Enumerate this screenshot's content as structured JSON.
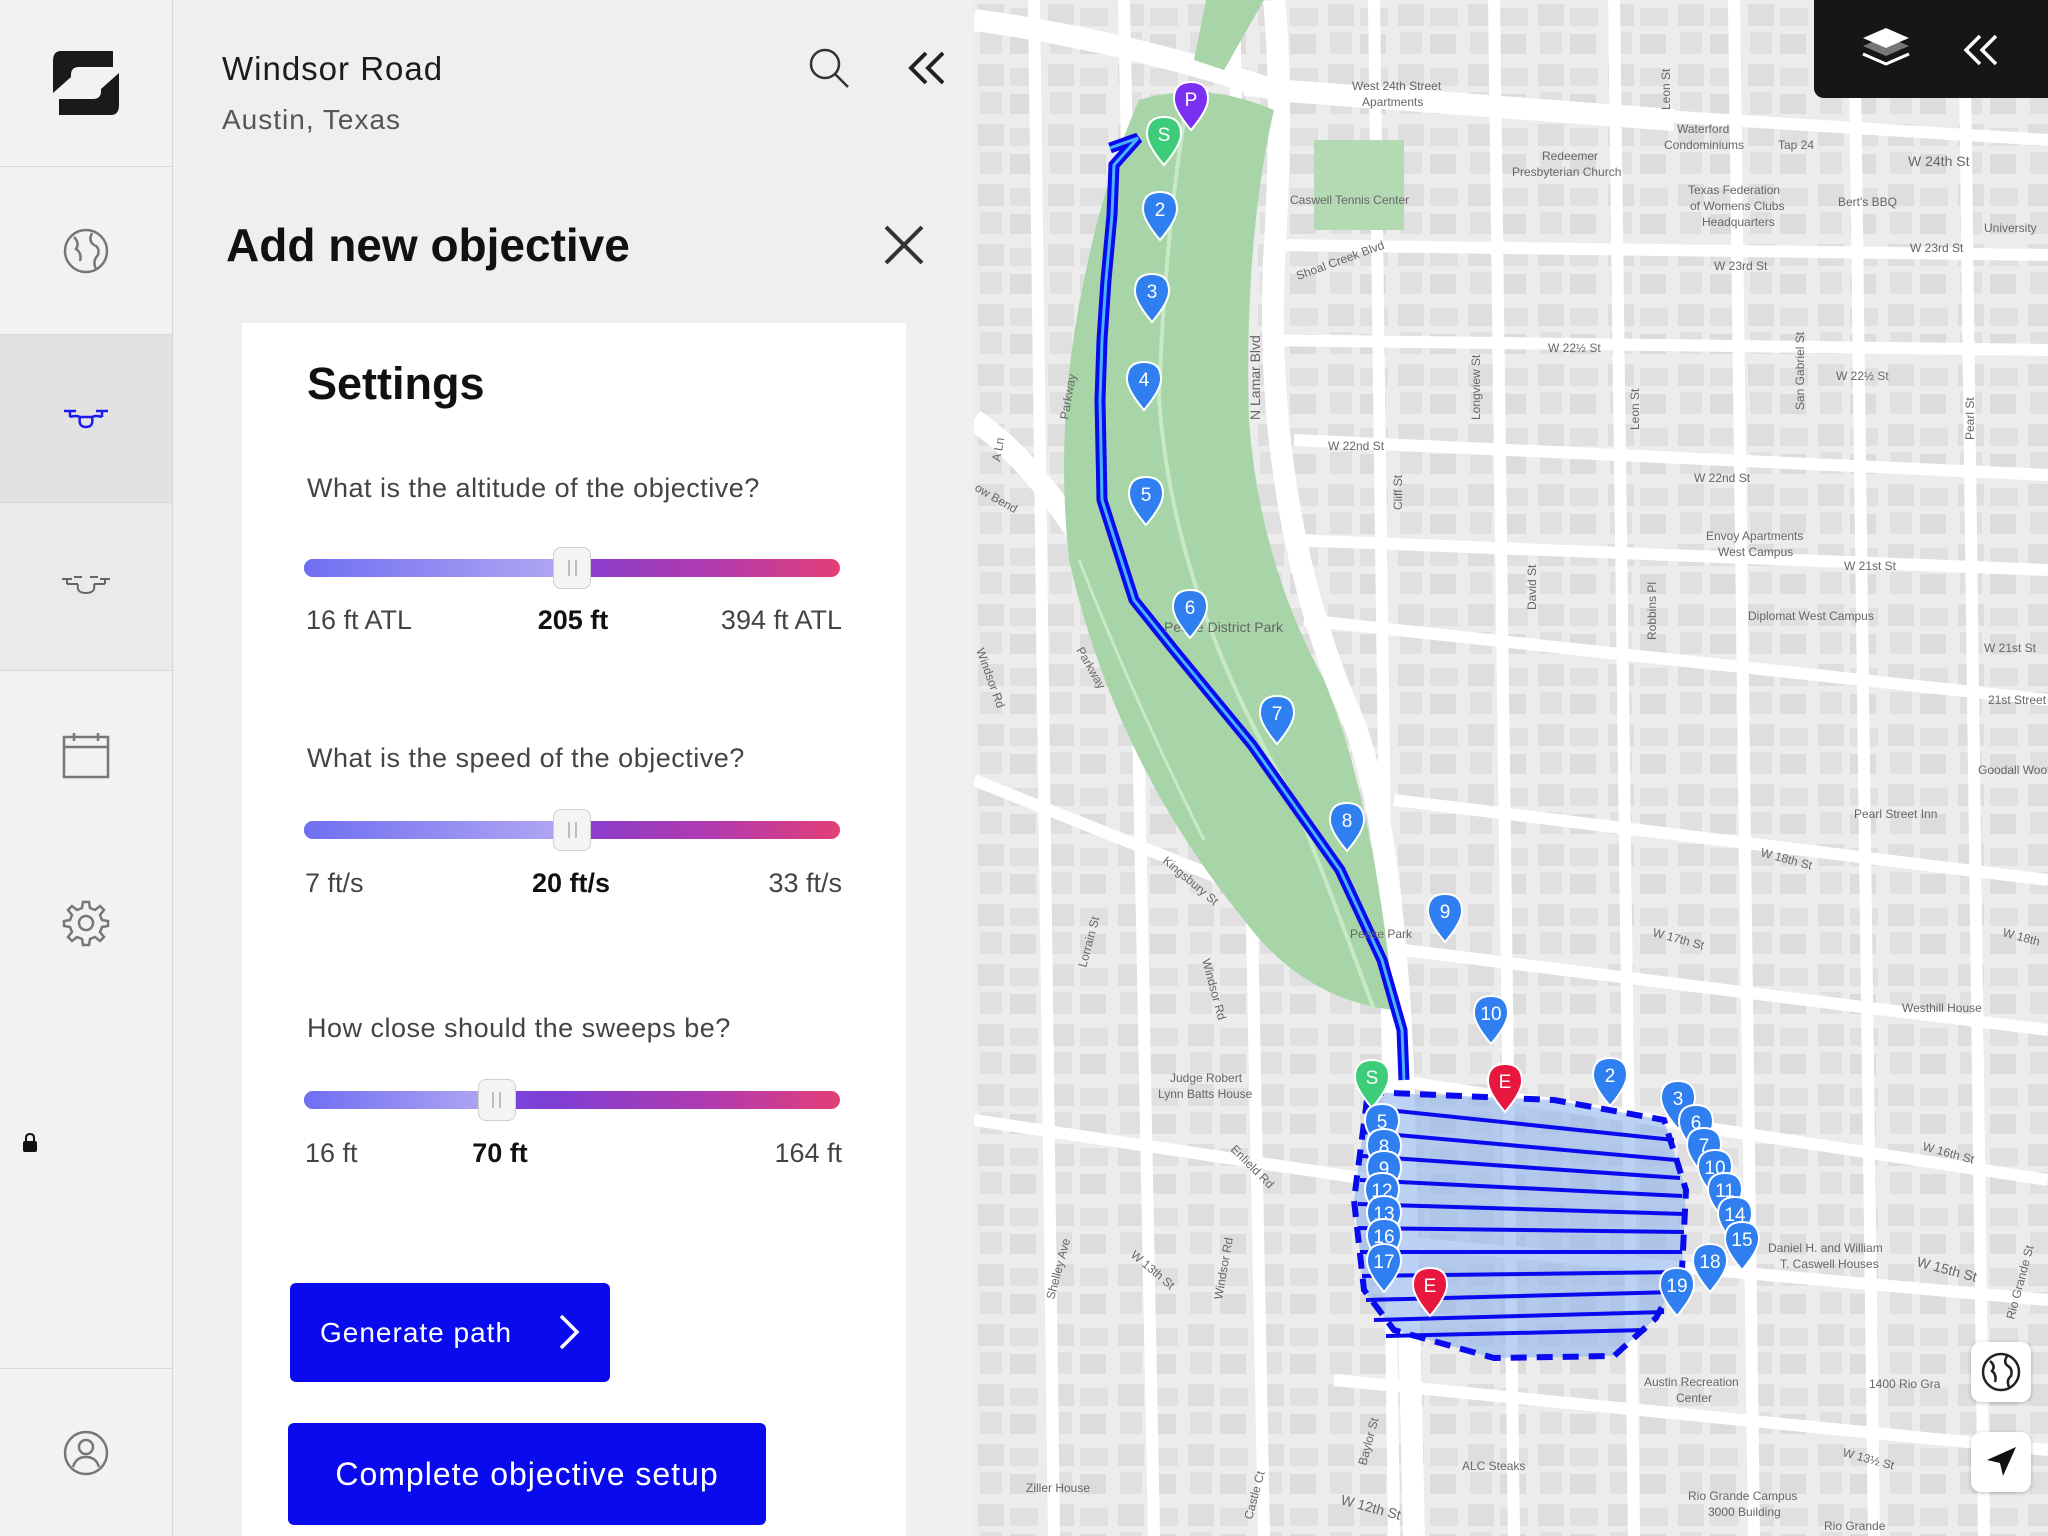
{
  "location": {
    "title": "Windsor Road",
    "subtitle": "Austin, Texas"
  },
  "objective": {
    "title": "Add new objective",
    "settings_heading": "Settings",
    "altitude": {
      "question": "What is the altitude of the objective?",
      "min_label": "16 ft ATL",
      "value_label": "205 ft",
      "max_label": "394 ft ATL",
      "fraction": 0.5
    },
    "speed": {
      "question": "What is the speed of the objective?",
      "min_label": "7 ft/s",
      "value_label": "20 ft/s",
      "max_label": "33 ft/s",
      "fraction": 0.5
    },
    "sweeps": {
      "question": "How close should the sweeps be?",
      "min_label": "16 ft",
      "value_label": "70 ft",
      "max_label": "164 ft",
      "fraction": 0.36
    },
    "generate_label": "Generate path",
    "complete_label": "Complete objective setup"
  },
  "rail": {
    "items": [
      {
        "name": "globe",
        "active": false
      },
      {
        "name": "drone",
        "active": true
      },
      {
        "name": "drone-swarm",
        "locked": true
      },
      {
        "name": "calendar"
      },
      {
        "name": "settings"
      },
      {
        "name": "profile"
      }
    ]
  },
  "map": {
    "labels": {
      "w24_apts": "West 24th Street",
      "w24_apts2": "Apartments",
      "redeemer": "Redeemer",
      "redeemer2": "Presbyterian Church",
      "caswell": "Caswell Tennis Center",
      "waterford": "Waterford",
      "waterford2": "Condominiums",
      "tap24": "Tap 24",
      "texas_fed": "Texas Federation",
      "texas_fed2": "of Womens Clubs",
      "texas_fed3": "Headquarters",
      "berts": "Bert's BBQ",
      "university": "University",
      "w24st": "W 24th St",
      "w23st": "W 23rd St",
      "w23st_b": "W 23rd St",
      "shoal_creek_blvd": "Shoal Creek Blvd",
      "w22half": "W 22½ St",
      "w22half_b": "W 22½ St",
      "w22nd": "W 22nd St",
      "w22nd_b": "W 22nd St",
      "n_lamar_blvd": "N Lamar Blvd",
      "longview": "Longview St",
      "leon": "Leon St",
      "leon_b": "Leon St",
      "san_gabriel": "San Gabriel St",
      "pearl": "Pearl St",
      "envoy": "Envoy Apartments",
      "envoy2": "West Campus",
      "w21st": "W 21st St",
      "w21st_b": "W 21st St",
      "diplomat": "Diplomat West Campus",
      "street21": "21st Street",
      "goodall": "Goodall Wooten",
      "pease": "Pease District Park",
      "pease_park": "Pease Park",
      "cliff": "Cliff St",
      "david": "David St",
      "robbins": "Robbins Pl",
      "parkway": "Parkway",
      "windsor_rd": "Windsor Rd",
      "kingsbury": "Kingsbury St",
      "lorrain": "Lorrain St",
      "pearl_inn": "Pearl Street Inn",
      "w18th": "W 18th St",
      "w17th": "W 17th St",
      "w18th_b": "W 18th",
      "westhill": "Westhill House",
      "judge": "Judge Robert",
      "judge2": "Lynn Batts House",
      "enfield": "Enfield Rd",
      "w16th": "W 16th St",
      "caswell_houses": "Daniel H. and William",
      "caswell_houses2": "T. Caswell Houses",
      "w15th": "W 15th St",
      "shelley": "Shelley Ave",
      "w13th": "W 13th St",
      "austin_rec": "Austin Recreation",
      "austin_rec2": "Center",
      "rio_grande_1400": "1400 Rio Gra",
      "w13half": "W 13½ St",
      "alc": "ALC Steaks",
      "ziller": "Ziller House",
      "baylor": "Baylor St",
      "castle": "Castle Ct",
      "w12th": "W 12th St",
      "rio_grande_campus": "Rio Grande Campus",
      "rio_grande_campus2": "3000 Building",
      "rio_grande": "Rio Grande",
      "rio_grande_st": "Rio Grande St",
      "ln": "A Ln",
      "bend": "ow Bend"
    },
    "pins": {
      "p": "P",
      "s": "S",
      "e": "E",
      "s2": "S",
      "e2": "E",
      "n2": "2",
      "n3": "3",
      "n4": "4",
      "n5": "5",
      "n6": "6",
      "n7": "7",
      "n8": "8",
      "n9": "9",
      "n10": "10",
      "g2": "2",
      "g3": "3",
      "g5": "5",
      "g6": "6",
      "g7": "7",
      "g8": "8",
      "g9": "9",
      "g10": "10",
      "g11": "11",
      "g12": "12",
      "g13": "13",
      "g14": "14",
      "g15": "15",
      "g16": "16",
      "g17": "17",
      "g18": "18",
      "g19": "19"
    },
    "colors": {
      "pin_blue": "#2f7ff0",
      "pin_red": "#e8173d",
      "pin_green": "#3dcc7a",
      "pin_purple": "#7b2ff0",
      "path": "#0a0aee",
      "park": "#a8d5a8"
    }
  }
}
